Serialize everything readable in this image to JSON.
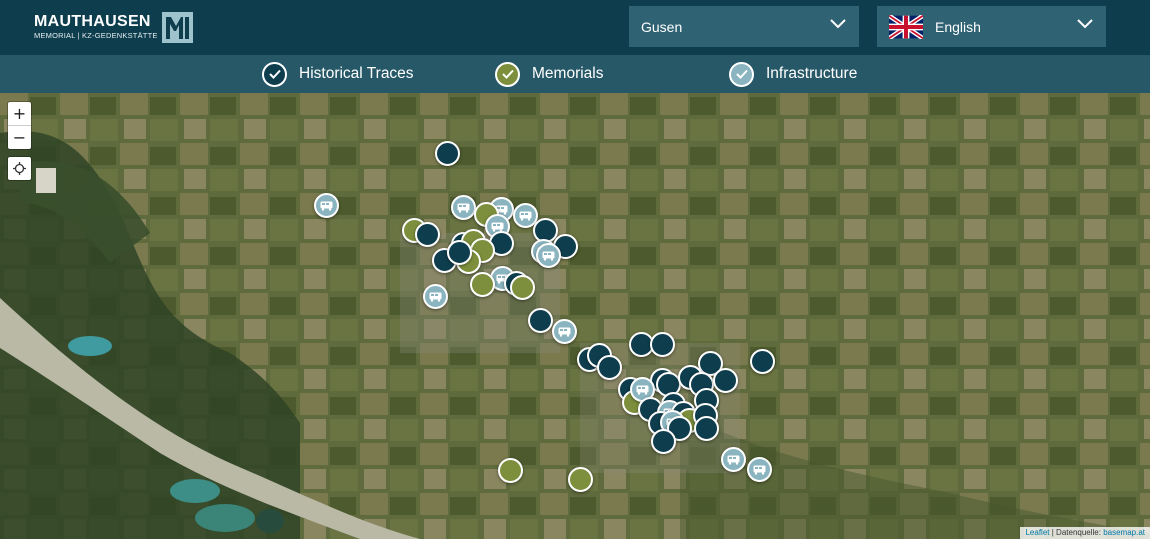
{
  "header": {
    "logo": {
      "main": "MAUTHAUSEN",
      "sub": "MEMORIAL | KZ-GEDENKSTÄTTE"
    },
    "location_select": {
      "value": "Gusen"
    },
    "language_select": {
      "value": "English",
      "flag_icon": "uk-flag-icon"
    }
  },
  "filters": [
    {
      "label": "Historical Traces",
      "color": "#0e3d4d"
    },
    {
      "label": "Memorials",
      "color": "#7d8f3c"
    },
    {
      "label": "Infrastructure",
      "color": "#8ab4bf"
    }
  ],
  "map": {
    "zoom_in": "+",
    "zoom_out": "−",
    "attribution": {
      "leaflet": "Leaflet",
      "sep": " | Datenquelle: ",
      "source": "basemap.at"
    }
  },
  "colors": {
    "header_bg": "#0e3d4d",
    "filterbar_bg": "#275868",
    "historical": "#0e3d4d",
    "memorial": "#7d8f3c",
    "infrastructure": "#8ab4bf"
  }
}
